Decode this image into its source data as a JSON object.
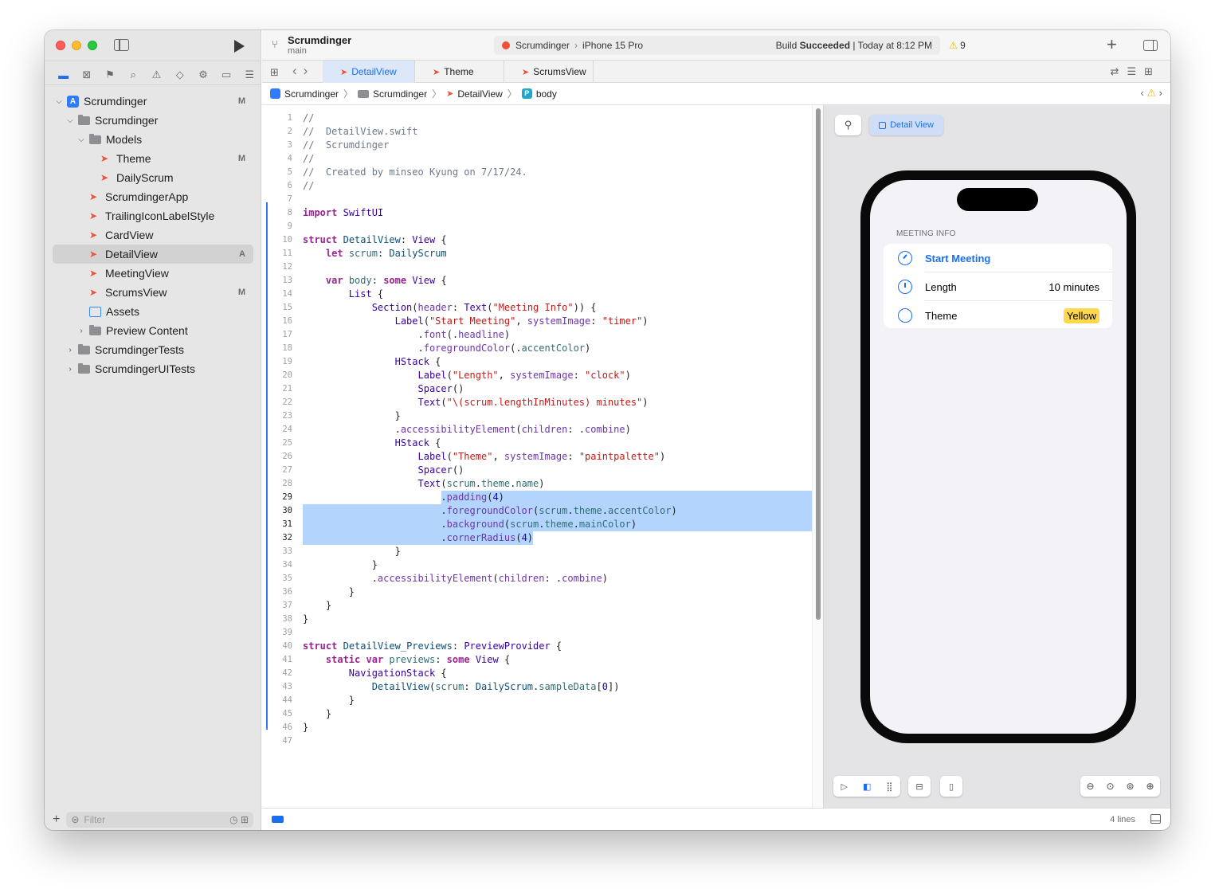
{
  "window": {
    "project": "Scrumdinger",
    "branch": "main"
  },
  "activity": {
    "scheme": "Scrumdinger",
    "device": "iPhone 15 Pro",
    "status_prefix": "Build",
    "status_bold": "Succeeded",
    "status_suffix": "| Today at 8:12 PM",
    "warnings": "9"
  },
  "navigator": {
    "icons": [
      "folder-icon",
      "source-control-icon",
      "bookmark-icon",
      "find-icon",
      "issue-icon",
      "test-icon",
      "debug-icon",
      "breakpoint-icon",
      "report-icon"
    ],
    "tree": [
      {
        "label": "Scrumdinger",
        "badge": "M",
        "kind": "project",
        "depth": 0,
        "disclosure": "⌄"
      },
      {
        "label": "Scrumdinger",
        "badge": "",
        "kind": "folder",
        "depth": 1,
        "disclosure": "⌄"
      },
      {
        "label": "Models",
        "badge": "",
        "kind": "folder",
        "depth": 2,
        "disclosure": "⌄"
      },
      {
        "label": "Theme",
        "badge": "M",
        "kind": "swift",
        "depth": 3,
        "disclosure": ""
      },
      {
        "label": "DailyScrum",
        "badge": "",
        "kind": "swift",
        "depth": 3,
        "disclosure": ""
      },
      {
        "label": "ScrumdingerApp",
        "badge": "",
        "kind": "swift",
        "depth": 2,
        "disclosure": ""
      },
      {
        "label": "TrailingIconLabelStyle",
        "badge": "",
        "kind": "swift",
        "depth": 2,
        "disclosure": ""
      },
      {
        "label": "CardView",
        "badge": "",
        "kind": "swift",
        "depth": 2,
        "disclosure": ""
      },
      {
        "label": "DetailView",
        "badge": "A",
        "kind": "swift",
        "depth": 2,
        "disclosure": "",
        "selected": true
      },
      {
        "label": "MeetingView",
        "badge": "",
        "kind": "swift",
        "depth": 2,
        "disclosure": ""
      },
      {
        "label": "ScrumsView",
        "badge": "M",
        "kind": "swift",
        "depth": 2,
        "disclosure": ""
      },
      {
        "label": "Assets",
        "badge": "",
        "kind": "assets",
        "depth": 2,
        "disclosure": ""
      },
      {
        "label": "Preview Content",
        "badge": "",
        "kind": "folder",
        "depth": 2,
        "disclosure": "›"
      },
      {
        "label": "ScrumdingerTests",
        "badge": "",
        "kind": "folder",
        "depth": 1,
        "disclosure": "›"
      },
      {
        "label": "ScrumdingerUITests",
        "badge": "",
        "kind": "folder",
        "depth": 1,
        "disclosure": "›"
      }
    ],
    "filter_placeholder": "Filter"
  },
  "tabs": [
    {
      "label": "DetailView",
      "active": true
    },
    {
      "label": "Theme",
      "active": false
    },
    {
      "label": "ScrumsView",
      "active": false
    }
  ],
  "jumpbar": [
    "Scrumdinger",
    "Scrumdinger",
    "DetailView",
    "body"
  ],
  "editor": {
    "lines": [
      "//",
      "//  DetailView.swift",
      "//  Scrumdinger",
      "//",
      "//  Created by minseo Kyung on 7/17/24.",
      "//",
      "",
      "import SwiftUI",
      "",
      "struct DetailView: View {",
      "    let scrum: DailyScrum",
      "",
      "    var body: some View {",
      "        List {",
      "            Section(header: Text(\"Meeting Info\")) {",
      "                Label(\"Start Meeting\", systemImage: \"timer\")",
      "                    .font(.headline)",
      "                    .foregroundColor(.accentColor)",
      "                HStack {",
      "                    Label(\"Length\", systemImage: \"clock\")",
      "                    Spacer()",
      "                    Text(\"\\(scrum.lengthInMinutes) minutes\")",
      "                }",
      "                .accessibilityElement(children: .combine)",
      "                HStack {",
      "                    Label(\"Theme\", systemImage: \"paintpalette\")",
      "                    Spacer()",
      "                    Text(scrum.theme.name)",
      "                        .padding(4)",
      "                        .foregroundColor(scrum.theme.accentColor)",
      "                        .background(scrum.theme.mainColor)",
      "                        .cornerRadius(4)",
      "                }",
      "            }",
      "            .accessibilityElement(children: .combine)",
      "        }",
      "    }",
      "}",
      "",
      "struct DetailView_Previews: PreviewProvider {",
      "    static var previews: some View {",
      "        NavigationStack {",
      "            DetailView(scrum: DailyScrum.sampleData[0])",
      "        }",
      "    }",
      "}",
      ""
    ],
    "selected_lines": [
      29,
      30,
      31,
      32
    ]
  },
  "preview": {
    "title": "Detail View",
    "section_header": "MEETING INFO",
    "rows": {
      "start": "Start Meeting",
      "length_label": "Length",
      "length_value": "10 minutes",
      "theme_label": "Theme",
      "theme_value": "Yellow"
    }
  },
  "statusbar": {
    "lines": "4 lines"
  },
  "colors": {
    "accent": "#1a6ff0",
    "selection": "#b3d4fc",
    "theme_yellow": "#ffd84d",
    "swift_orange": "#f05138"
  }
}
